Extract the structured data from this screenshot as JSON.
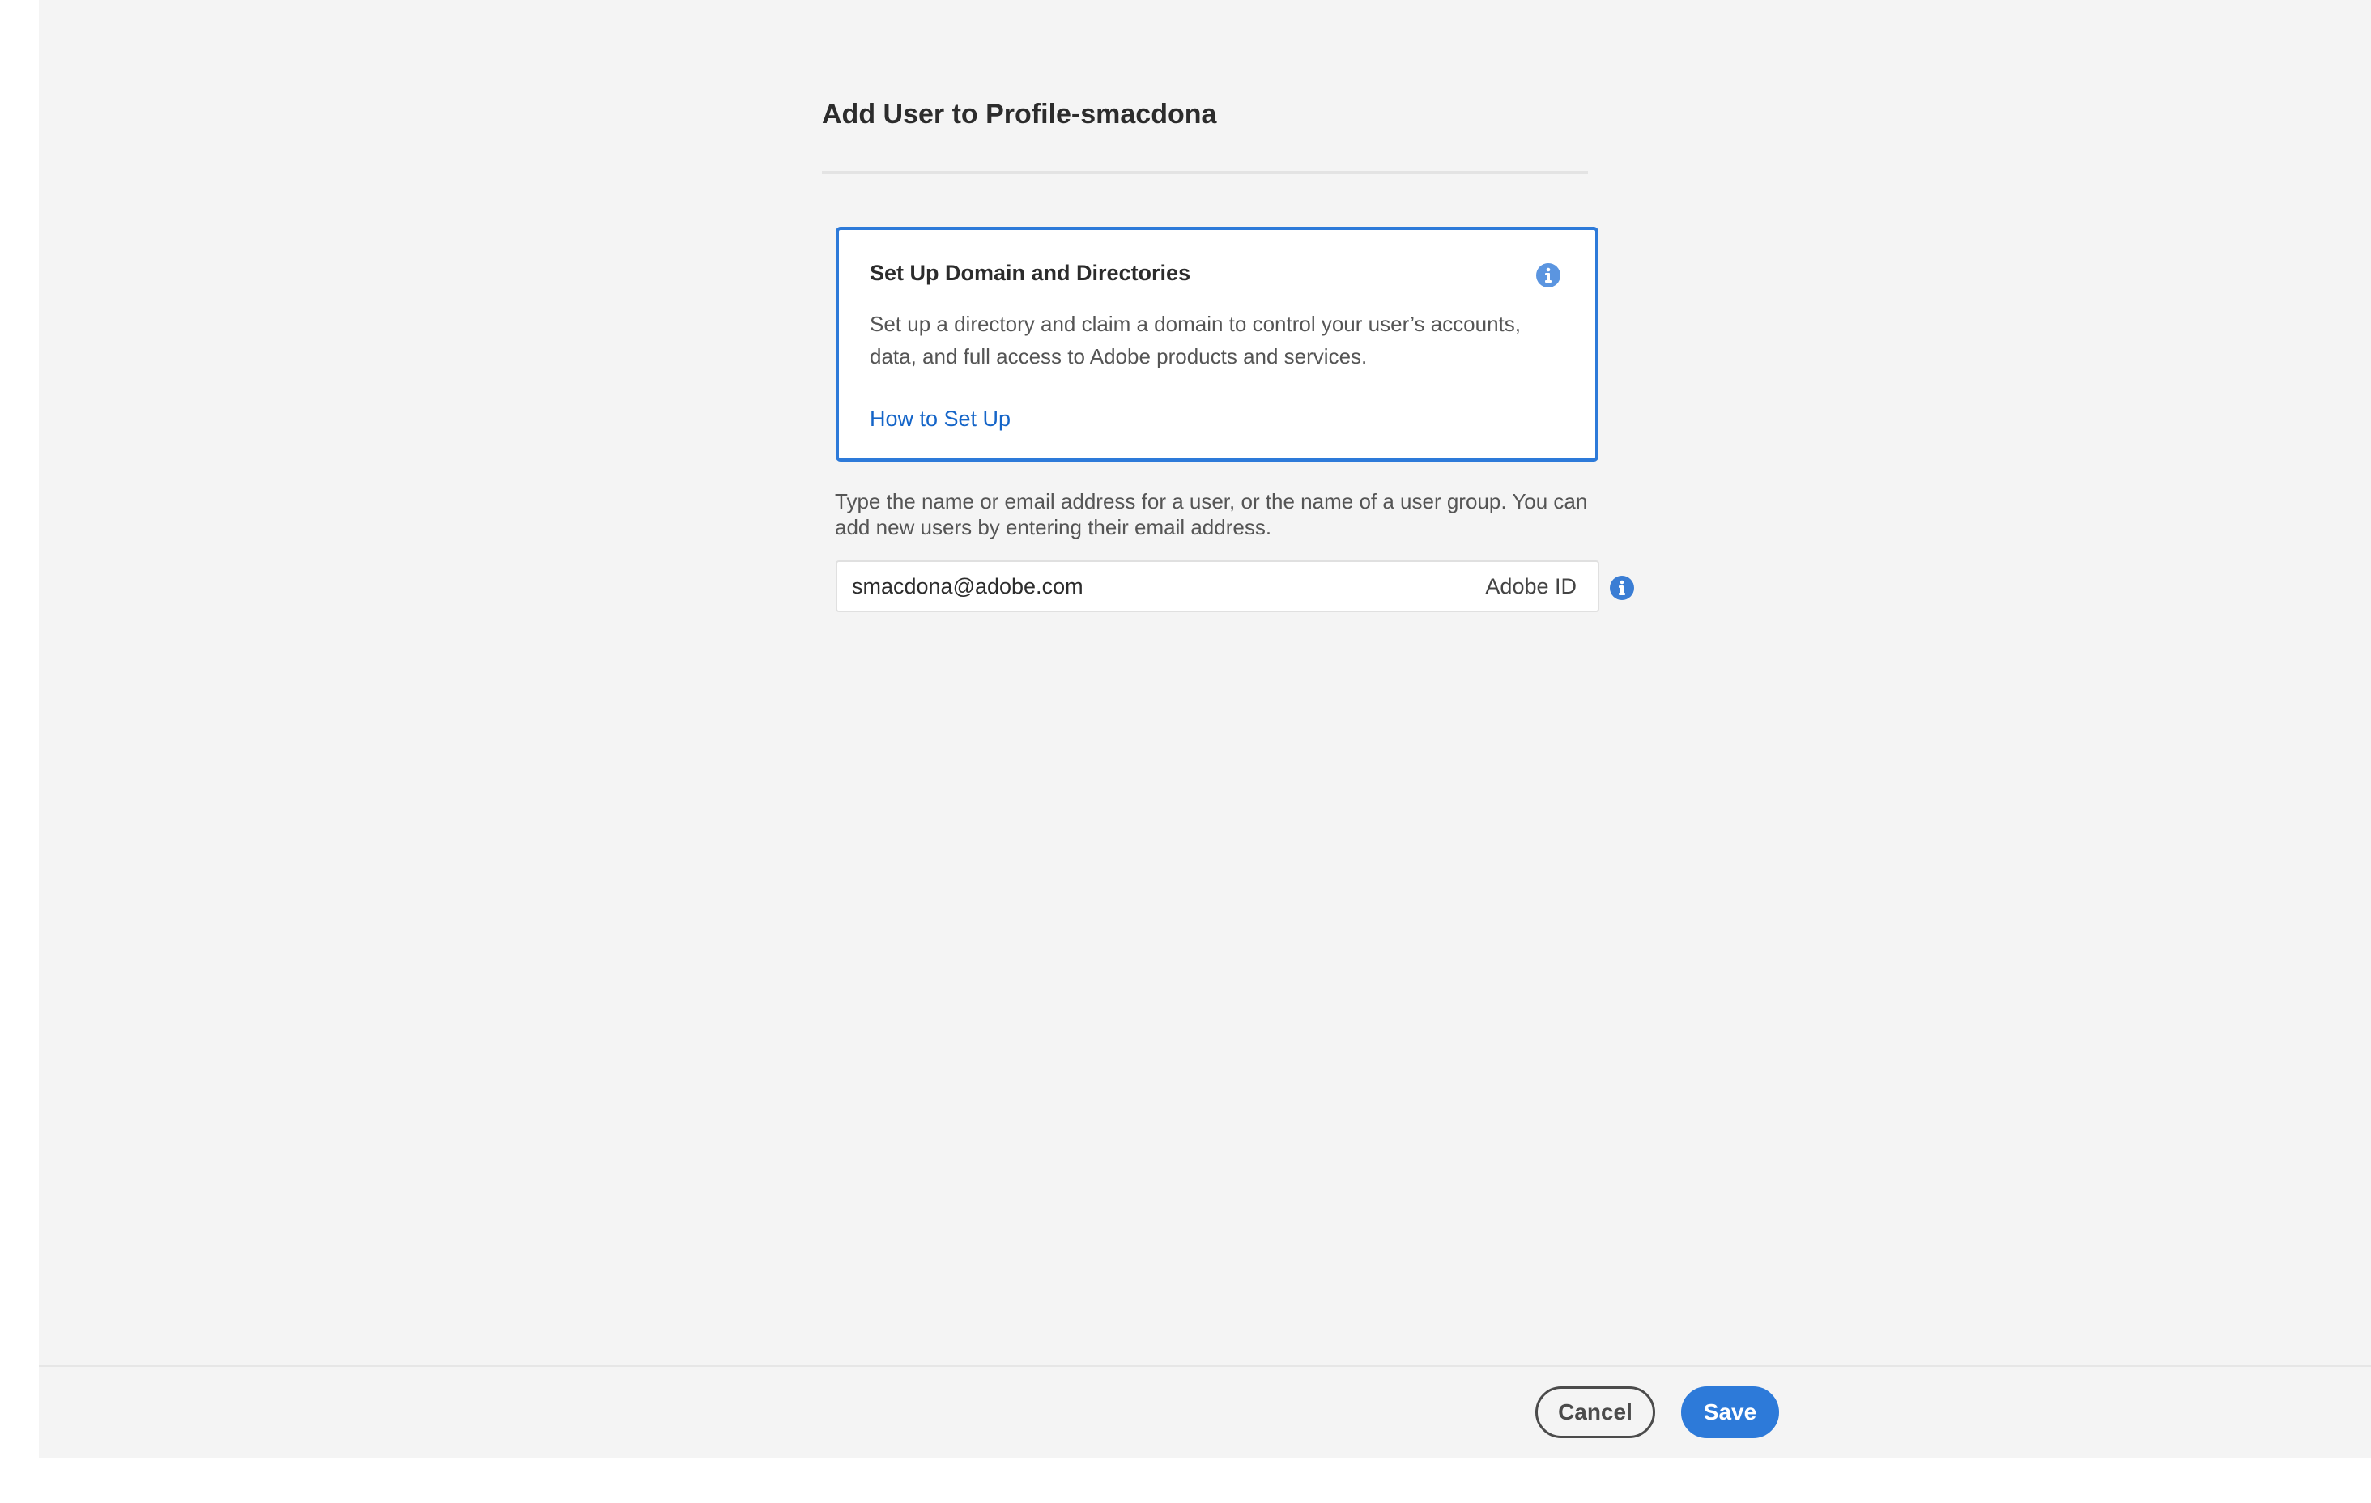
{
  "dialog": {
    "title": "Add User to Profile-smacdona"
  },
  "info_card": {
    "title": "Set Up Domain and Directories",
    "body": "Set up a directory and claim a domain to control your user’s accounts, data, and full access to Adobe products and services.",
    "link_label": "How to Set Up",
    "icon": "info-icon"
  },
  "user_field": {
    "help_text": "Type the name or email address for a user, or the name of a user group. You can add new users by entering their email address.",
    "value": "smacdona@adobe.com",
    "id_type": "Adobe ID",
    "icon": "info-icon"
  },
  "footer": {
    "cancel_label": "Cancel",
    "save_label": "Save"
  },
  "colors": {
    "accent": "#2d7ad9",
    "link": "#1565c8",
    "background": "#f4f4f4"
  }
}
